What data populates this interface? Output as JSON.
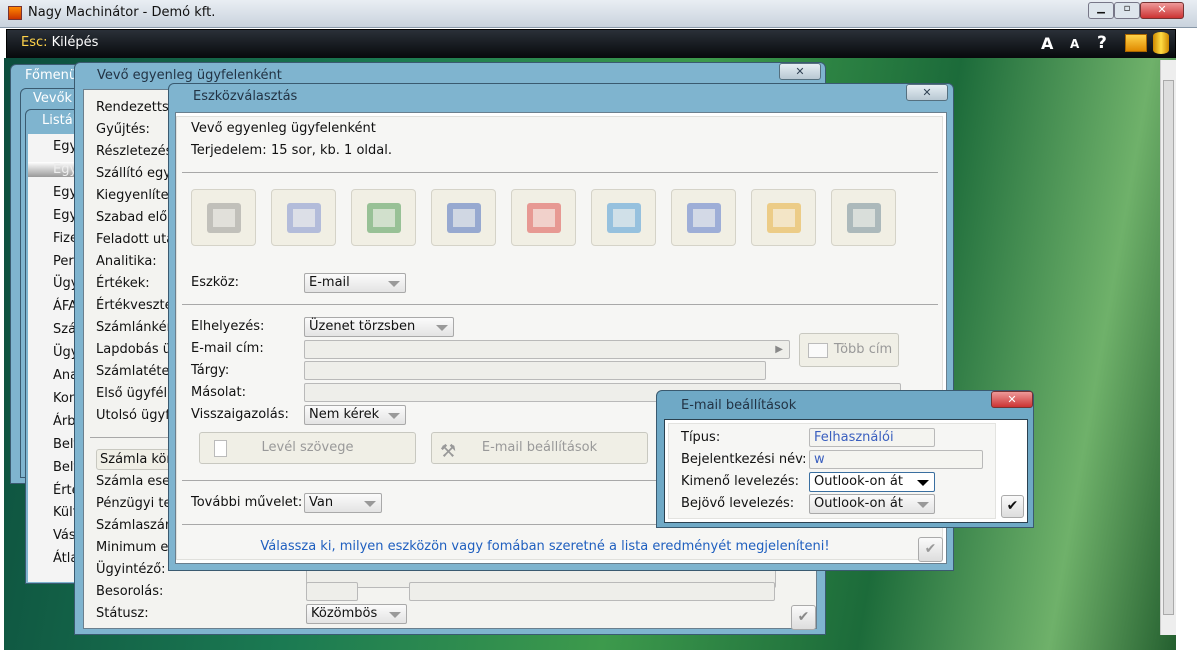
{
  "app": {
    "title": "Nagy Machinátor - Demó kft.",
    "esc_key": "Esc:",
    "esc_label": "Kilépés",
    "font_big": "A",
    "font_small": "A",
    "help": "?"
  },
  "back_windows": {
    "main_menu": "Főmenü",
    "customers": "Vevők",
    "lists": "Listák",
    "list_items": [
      "Egy",
      "Egy",
      "Egy",
      "Egy",
      "Fize",
      "Per",
      "Ügy",
      "ÁFA",
      "Szá",
      "Ügy",
      "Ana",
      "Kon",
      "Árb",
      "Belf",
      "Belf",
      "Érte",
      "Külf",
      "Vás",
      "Átla"
    ],
    "selected_index": 1
  },
  "report_window": {
    "title": "Vevő egyenleg ügyfelenként",
    "labels_top": [
      "Rendezettsé",
      "Gyűjtés:",
      "Részletezés:",
      "Szállító egye",
      "Kiegyenlített",
      "Szabad előle",
      "Feladott uta",
      "Analitika:",
      "Értékek:",
      "Értékvesztés",
      "Számlánként",
      "Lapdobás üg",
      "Számlatétel",
      "Első ügyfél:",
      "Utolsó ügyfé"
    ],
    "invoice_button": "Számla kön",
    "labels_bottom": [
      "Számla esed",
      "Pénzügyi tel",
      "Számlaszám",
      "Minimum eg",
      "Ügyintéző:",
      "Besorolás:",
      "Státusz:"
    ],
    "status_value": "Közömbös"
  },
  "tool_dialog": {
    "title": "Eszközválasztás",
    "report_name": "Vevő egyenleg ügyfelenként",
    "extent_label": "Terjedelem:",
    "extent_value": "15 sor, kb.  1 oldal.",
    "tools": [
      "printer",
      "preview",
      "excel",
      "word",
      "pdf",
      "internet-explorer",
      "screen",
      "outlook",
      "archive"
    ],
    "device_label": "Eszköz:",
    "device_value": "E-mail",
    "placement_label": "Elhelyezés:",
    "placement_value": "Üzenet törzsben",
    "email_label": "E-mail cím:",
    "email_value": "",
    "more_addresses": "Több cím",
    "subject_label": "Tárgy:",
    "subject_value": "",
    "copy_label": "Másolat:",
    "copy_value": "",
    "receipt_label": "Visszaigazolás:",
    "receipt_value": "Nem kérek",
    "letter_text_button": "Levél szövege",
    "email_settings_button": "E-mail beállítások",
    "further_action_label": "További művelet:",
    "further_action_value": "Van",
    "hint": "Válassza ki, milyen eszközön vagy fomában szeretné a lista eredményét megjeleníteni!"
  },
  "email_settings": {
    "title": "E-mail beállítások",
    "type_label": "Típus:",
    "type_value": "Felhasználói",
    "login_label": "Bejelentkezési név:",
    "login_value": "w",
    "outgoing_label": "Kimenő levelezés:",
    "outgoing_value": "Outlook-on át",
    "incoming_label": "Bejövő levelezés:",
    "incoming_value": "Outlook-on át"
  }
}
